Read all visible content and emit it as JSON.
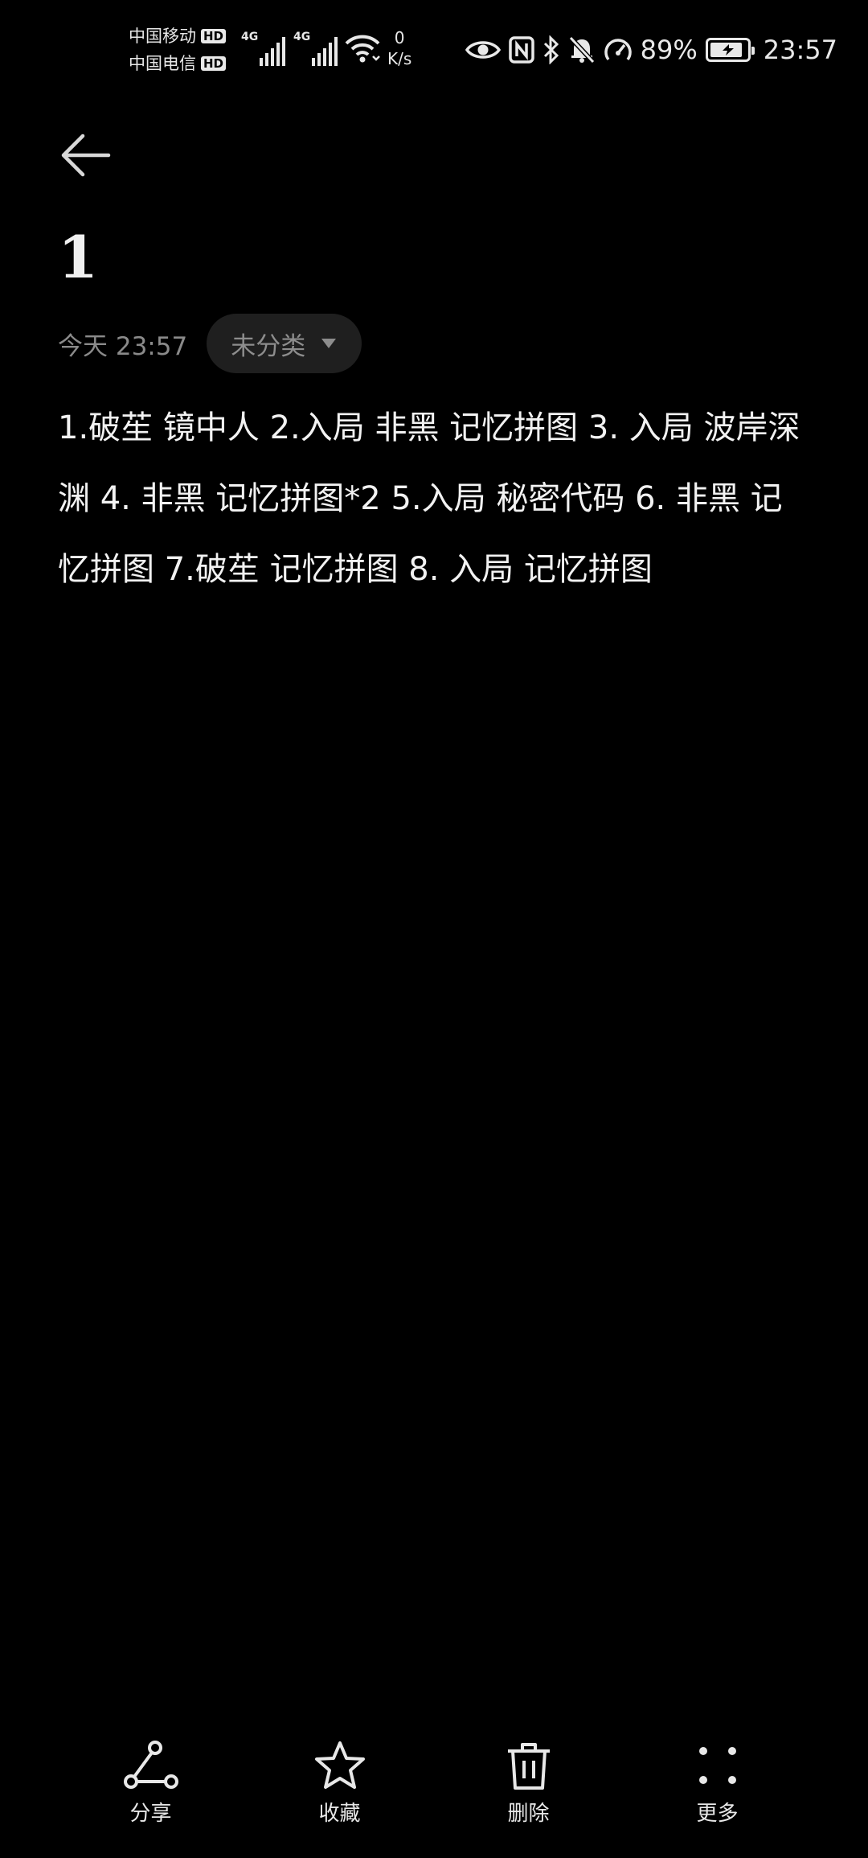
{
  "status_bar": {
    "carrier_1": "中国移动",
    "carrier_2": "中国电信",
    "hd_badge": "HD",
    "network_gen_1": "4G",
    "network_gen_2": "4G",
    "speed_value": "0",
    "speed_unit": "K/s",
    "battery_percent": "89%",
    "battery_level": 0.89,
    "time": "23:57",
    "icons": [
      "eye-comfort-icon",
      "nfc-icon",
      "bluetooth-icon",
      "mute-bell-icon",
      "speed-gauge-icon"
    ]
  },
  "header": {
    "back_icon": "arrow-left-icon",
    "title": "1",
    "date": "今天 23:57",
    "category": "未分类"
  },
  "note": {
    "body": "1.破苼 镜中人 2.入局 非黑 记忆拼图 3. 入局 波岸深渊 4. 非黑 记忆拼图*2 5.入局 秘密代码 6. 非黑 记忆拼图 7.破苼 记忆拼图 8. 入局 记忆拼图"
  },
  "toolbar": {
    "share_label": "分享",
    "favorite_label": "收藏",
    "delete_label": "删除",
    "more_label": "更多"
  },
  "colors": {
    "background": "#000000",
    "text": "#f2f2f2",
    "muted": "#8a8a8a",
    "chip": "#1f1f1f"
  }
}
